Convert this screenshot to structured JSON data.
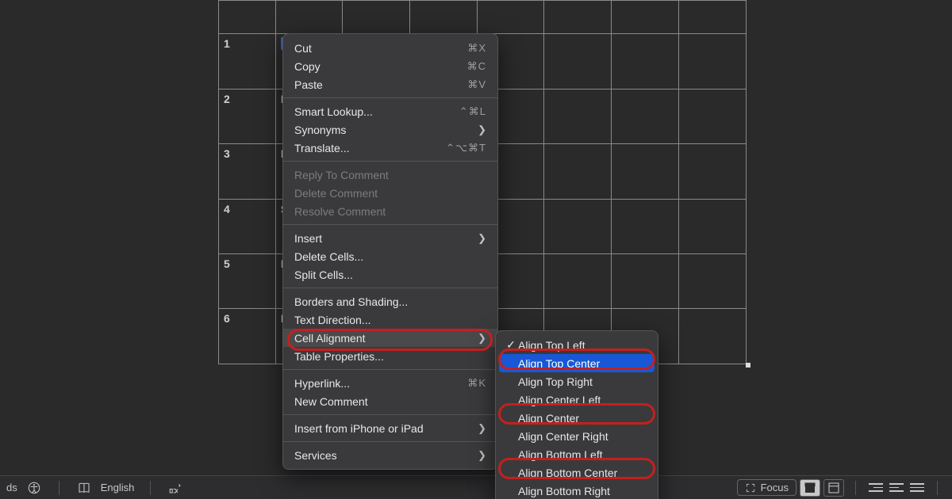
{
  "table": {
    "rows": [
      {
        "num": "",
        "col2": ""
      },
      {
        "num": "1",
        "col2": "HY"
      },
      {
        "num": "2",
        "col2": "DI"
      },
      {
        "num": "3",
        "col2": "FD"
      },
      {
        "num": "4",
        "col2": "SS"
      },
      {
        "num": "5",
        "col2": "LL"
      },
      {
        "num": "6",
        "col2": "LC"
      }
    ]
  },
  "context_menu": {
    "groups": [
      [
        {
          "label": "Cut",
          "shortcut": "⌘X"
        },
        {
          "label": "Copy",
          "shortcut": "⌘C"
        },
        {
          "label": "Paste",
          "shortcut": "⌘V"
        }
      ],
      [
        {
          "label": "Smart Lookup...",
          "shortcut": "⌃⌘L"
        },
        {
          "label": "Synonyms",
          "submenu": true
        },
        {
          "label": "Translate...",
          "shortcut": "⌃⌥⌘T"
        }
      ],
      [
        {
          "label": "Reply To Comment",
          "disabled": true
        },
        {
          "label": "Delete Comment",
          "disabled": true
        },
        {
          "label": "Resolve Comment",
          "disabled": true
        }
      ],
      [
        {
          "label": "Insert",
          "submenu": true
        },
        {
          "label": "Delete Cells..."
        },
        {
          "label": "Split Cells..."
        }
      ],
      [
        {
          "label": "Borders and Shading..."
        },
        {
          "label": "Text Direction..."
        },
        {
          "label": "Cell Alignment",
          "submenu": true,
          "hover": true,
          "ring": true
        },
        {
          "label": "Table Properties..."
        }
      ],
      [
        {
          "label": "Hyperlink...",
          "shortcut": "⌘K"
        },
        {
          "label": "New Comment"
        }
      ],
      [
        {
          "label": "Insert from iPhone or iPad",
          "submenu": true
        }
      ],
      [
        {
          "label": "Services",
          "submenu": true
        }
      ]
    ]
  },
  "submenu": {
    "items": [
      {
        "label": "Align Top Left",
        "checked": true
      },
      {
        "label": "Align Top Center",
        "selected": true,
        "ring": true
      },
      {
        "label": "Align Top Right"
      },
      {
        "label": "Align Center Left"
      },
      {
        "label": "Align Center",
        "ring": true
      },
      {
        "label": "Align Center Right"
      },
      {
        "label": "Align Bottom Left"
      },
      {
        "label": "Align Bottom Center",
        "ring": true
      },
      {
        "label": "Align Bottom Right"
      }
    ]
  },
  "status": {
    "left_truncated": "ds",
    "language": "English",
    "focus": "Focus"
  },
  "annotation_ring_color": "#c3201f"
}
